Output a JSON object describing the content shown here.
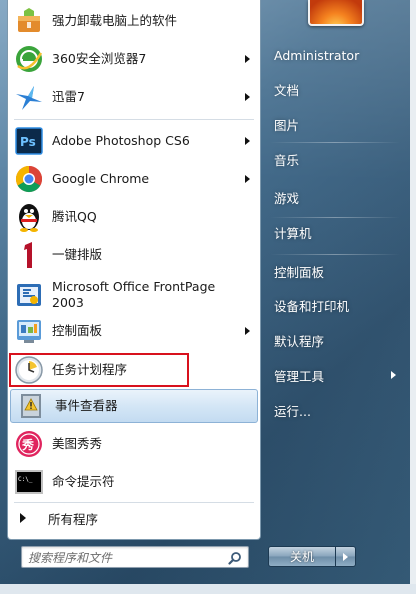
{
  "programs": [
    {
      "label": "强力卸载电脑上的软件",
      "icon": "uninstall-box-icon",
      "arrow": false
    },
    {
      "label": "360安全浏览器7",
      "icon": "360-browser-icon",
      "arrow": true
    },
    {
      "label": "迅雷7",
      "icon": "thunder-bird-icon",
      "arrow": true
    },
    {
      "label": "Adobe Photoshop CS6",
      "icon": "photoshop-icon",
      "arrow": true
    },
    {
      "label": "Google Chrome",
      "icon": "chrome-icon",
      "arrow": true
    },
    {
      "label": "腾讯QQ",
      "icon": "qq-penguin-icon",
      "arrow": false
    },
    {
      "label": "一键排版",
      "icon": "number-one-icon",
      "arrow": false
    },
    {
      "label": "Microsoft Office FrontPage\n2003",
      "icon": "frontpage-icon",
      "arrow": false
    },
    {
      "label": "控制面板",
      "icon": "control-panel-icon",
      "arrow": true
    },
    {
      "label": "任务计划程序",
      "icon": "task-scheduler-clock-icon",
      "arrow": false
    },
    {
      "label": "事件查看器",
      "icon": "event-viewer-icon",
      "arrow": false
    },
    {
      "label": "美图秀秀",
      "icon": "meitu-icon",
      "arrow": false
    },
    {
      "label": "命令提示符",
      "icon": "cmd-prompt-icon",
      "arrow": false
    }
  ],
  "all_programs_label": "所有程序",
  "search": {
    "placeholder": "搜索程序和文件"
  },
  "right_items": [
    {
      "label": "Administrator",
      "arrow": false
    },
    {
      "label": "文档",
      "arrow": false
    },
    {
      "label": "图片",
      "arrow": false
    },
    {
      "label": "音乐",
      "arrow": false
    },
    {
      "label": "游戏",
      "arrow": false
    },
    {
      "label": "计算机",
      "arrow": false
    },
    {
      "label": "控制面板",
      "arrow": false
    },
    {
      "label": "设备和打印机",
      "arrow": false
    },
    {
      "label": "默认程序",
      "arrow": false
    },
    {
      "label": "管理工具",
      "arrow": true
    },
    {
      "label": "运行...",
      "arrow": false
    }
  ],
  "shutdown_label": "关机",
  "colors": {
    "highlight_border": "#d8111d",
    "right_text": "#ffffff"
  }
}
